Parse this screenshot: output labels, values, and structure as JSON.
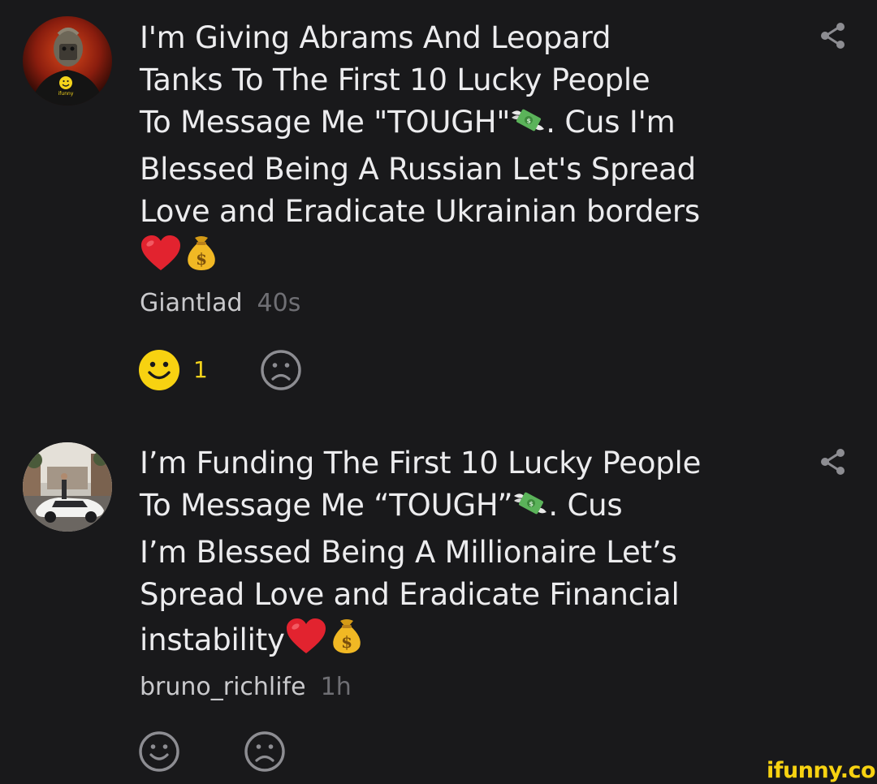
{
  "comments": [
    {
      "line1": "I'm Giving Abrams And Leopard",
      "line2": "Tanks To The First 10 Lucky People",
      "line3a": "To Message Me \"TOUGH\"",
      "line3b": ". Cus I'm",
      "line4": "Blessed Being A Russian Let's Spread",
      "line5": "Love and Eradicate Ukrainian borders",
      "author": "Giantlad",
      "time": "40s",
      "smile_count": "1",
      "avatar_icon": "masked-person-avatar",
      "inline_emojis": [
        "money-with-wings",
        "red-heart",
        "money-bag"
      ]
    },
    {
      "line1": "I’m Funding The First 10 Lucky People",
      "line2a": "To Message Me “TOUGH”",
      "line2b": ". Cus",
      "line3": "I’m Blessed Being A Millionaire Let’s",
      "line4": "Spread Love and Eradicate Financial",
      "line5": "instability",
      "author": "bruno_richlife",
      "time": "1h",
      "smile_count": "",
      "avatar_icon": "sports-car-avatar",
      "inline_emojis": [
        "money-with-wings",
        "red-heart",
        "money-bag"
      ]
    }
  ],
  "watermark": "ifunny.co",
  "colors": {
    "background": "#19191b",
    "text": "#ececee",
    "muted": "#6f6f74",
    "smile_active": "#f7d211",
    "icon_gray": "#8d8d92"
  }
}
